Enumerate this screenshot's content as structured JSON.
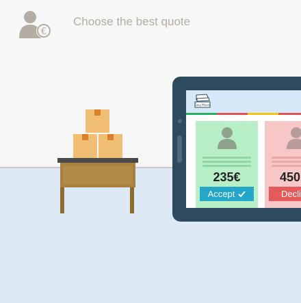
{
  "header": {
    "title": "Choose the best quote",
    "icon": "user-euro-icon"
  },
  "tablet": {
    "logo_text": "Easy Mover",
    "stripe_colors": [
      "#27ae60",
      "#e05252",
      "#f1c40f",
      "#e05252"
    ],
    "quotes": [
      {
        "price": "235€",
        "button_label": "Accept",
        "button_icon": "check-icon",
        "status": "accept",
        "color": "#b7efc6",
        "button_color": "#23a6c8"
      },
      {
        "price": "450",
        "button_label": "Declin",
        "status": "decline",
        "color": "#f7c7c8",
        "button_color": "#e55a5a"
      }
    ]
  },
  "scene": {
    "boxes_icon": "boxes-icon",
    "table_icon": "table-icon"
  }
}
